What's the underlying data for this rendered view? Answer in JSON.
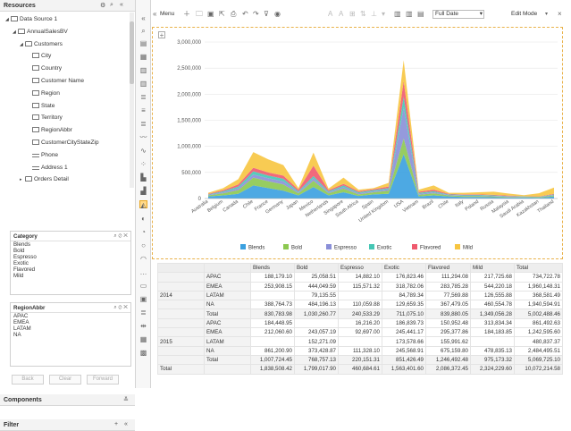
{
  "resources": {
    "title": "Resources",
    "icons": [
      "gear-icon",
      "search-icon",
      "collapse-icon"
    ]
  },
  "tree": [
    {
      "label": "Data Source 1",
      "depth": 0,
      "kind": "db",
      "toggle": "▲"
    },
    {
      "label": "AnnualSalesBV",
      "depth": 1,
      "kind": "folder",
      "toggle": "▲"
    },
    {
      "label": "Customers",
      "depth": 2,
      "kind": "folder",
      "toggle": "▲"
    },
    {
      "label": "City",
      "depth": 3,
      "kind": "field"
    },
    {
      "label": "Country",
      "depth": 3,
      "kind": "check"
    },
    {
      "label": "Customer Name",
      "depth": 3,
      "kind": "field"
    },
    {
      "label": "Region",
      "depth": 3,
      "kind": "field"
    },
    {
      "label": "State",
      "depth": 3,
      "kind": "field"
    },
    {
      "label": "Territory",
      "depth": 3,
      "kind": "field"
    },
    {
      "label": "RegionAbbr",
      "depth": 3,
      "kind": "field"
    },
    {
      "label": "CustomerCityStateZip",
      "depth": 3,
      "kind": "field"
    },
    {
      "label": "Phone",
      "depth": 3,
      "kind": "lines"
    },
    {
      "label": "Address 1",
      "depth": 3,
      "kind": "lines"
    },
    {
      "label": "Orders Detail",
      "depth": 2,
      "kind": "folder",
      "toggle": "▶"
    }
  ],
  "components": {
    "title": "Components"
  },
  "filter": {
    "title": "Filter",
    "add": "+",
    "collapse": "«"
  },
  "category": {
    "title": "Category",
    "values": [
      "Blends",
      "Bold",
      "Espresso",
      "Exotic",
      "Flavored",
      "Mild"
    ]
  },
  "region": {
    "title": "RegionAbbr",
    "values": [
      "APAC",
      "EMEA",
      "LATAM",
      "NA"
    ]
  },
  "buttons": {
    "back": "Back",
    "clear": "Clear",
    "forward": "Forward"
  },
  "toolbar": {
    "menu": "Menu",
    "date": "Full Date",
    "mode": "Edit Mode"
  },
  "chart_data": {
    "type": "area",
    "categories": [
      "Australia",
      "Belgium",
      "Canada",
      "Chile",
      "France",
      "Germany",
      "Japan",
      "Mexico",
      "Netherlands",
      "Singapore",
      "South Africa",
      "Spain",
      "United Kingdom",
      "USA",
      "Vietnam",
      "Brazil",
      "Chile",
      "Italy",
      "Poland",
      "Russia",
      "Malaysia",
      "Saudi Arabia",
      "Kazakhstan",
      "Thailand"
    ],
    "ylim": [
      0,
      3000000
    ],
    "yticks": [
      "0",
      "500,000",
      "1,000,000",
      "1,500,000",
      "2,000,000",
      "2,500,000",
      "3,000,000"
    ],
    "series": [
      {
        "name": "Blends",
        "color": "#3aa0e0",
        "values": [
          40000,
          60000,
          90000,
          250000,
          200000,
          150000,
          60000,
          220000,
          60000,
          120000,
          50000,
          80000,
          90000,
          850000,
          40000,
          60000,
          40000,
          30000,
          30000,
          25000,
          20000,
          20000,
          15000,
          40000
        ]
      },
      {
        "name": "Bold",
        "color": "#8cc850",
        "values": [
          20000,
          40000,
          70000,
          150000,
          130000,
          120000,
          40000,
          120000,
          40000,
          70000,
          30000,
          40000,
          60000,
          300000,
          30000,
          40000,
          20000,
          20000,
          20000,
          15000,
          10000,
          10000,
          10000,
          20000
        ]
      },
      {
        "name": "Espresso",
        "color": "#8a8fd8",
        "values": [
          10000,
          20000,
          40000,
          60000,
          60000,
          60000,
          20000,
          50000,
          20000,
          30000,
          20000,
          20000,
          30000,
          600000,
          20000,
          20000,
          10000,
          10000,
          10000,
          10000,
          10000,
          5000,
          5000,
          10000
        ]
      },
      {
        "name": "Exotic",
        "color": "#45c6b4",
        "values": [
          10000,
          20000,
          30000,
          60000,
          50000,
          50000,
          20000,
          40000,
          20000,
          30000,
          20000,
          20000,
          20000,
          200000,
          20000,
          20000,
          10000,
          10000,
          10000,
          10000,
          5000,
          5000,
          5000,
          10000
        ]
      },
      {
        "name": "Flavored",
        "color": "#ef5a6e",
        "values": [
          10000,
          20000,
          40000,
          70000,
          60000,
          60000,
          30000,
          200000,
          20000,
          30000,
          20000,
          20000,
          30000,
          300000,
          20000,
          30000,
          10000,
          10000,
          10000,
          10000,
          10000,
          5000,
          5000,
          10000
        ]
      },
      {
        "name": "Mild",
        "color": "#f7c540",
        "values": [
          20000,
          40000,
          100000,
          300000,
          250000,
          200000,
          30000,
          250000,
          30000,
          120000,
          30000,
          20000,
          70000,
          400000,
          40000,
          80000,
          20000,
          30000,
          40000,
          60000,
          40000,
          20000,
          60000,
          120000
        ]
      }
    ]
  },
  "table": {
    "headers": [
      "",
      "",
      "Blends",
      "Bold",
      "Espresso",
      "Exotic",
      "Flavored",
      "Mild",
      "Total"
    ],
    "rows": [
      [
        "",
        "APAC",
        "188,179.10",
        "25,058.51",
        "14,882.10",
        "176,823.46",
        "111,294.08",
        "217,725.68",
        "734,722.78"
      ],
      [
        "",
        "EMEA",
        "253,908.15",
        "444,049.59",
        "115,571.32",
        "318,782.06",
        "283,785.28",
        "544,220.18",
        "1,960,148.31"
      ],
      [
        "2014",
        "LATAM",
        "",
        "79,135.55",
        "",
        "84,789.34",
        "77,569.88",
        "126,555.88",
        "368,581.49"
      ],
      [
        "",
        "NA",
        "388,764.73",
        "484,196.13",
        "110,059.88",
        "129,659.35",
        "367,479.05",
        "460,554.78",
        "1,940,594.91"
      ],
      [
        "",
        "Total",
        "830,783.98",
        "1,030,260.77",
        "240,533.29",
        "711,075.10",
        "839,880.05",
        "1,349,056.28",
        "5,002,488.46"
      ],
      [
        "",
        "APAC",
        "184,448.95",
        "",
        "16,216.20",
        "186,839.73",
        "150,952.48",
        "313,834.34",
        "861,492.63"
      ],
      [
        "",
        "EMEA",
        "212,060.60",
        "243,057.19",
        "92,697.00",
        "245,441.17",
        "295,377.86",
        "184,183.85",
        "1,242,595.60"
      ],
      [
        "2015",
        "LATAM",
        "",
        "152,271.09",
        "",
        "173,578.66",
        "155,991.62",
        "",
        "480,837.37"
      ],
      [
        "",
        "NA",
        "861,200.90",
        "373,428.87",
        "111,328.10",
        "245,568.91",
        "675,159.80",
        "478,835.13",
        "2,484,495.51"
      ],
      [
        "",
        "Total",
        "1,007,724.45",
        "768,757.13",
        "220,151.31",
        "851,426.49",
        "1,246,492.48",
        "975,173.32",
        "5,069,725.10"
      ],
      [
        "Total",
        "",
        "1,838,508.42",
        "1,799,017.90",
        "460,684.61",
        "1,563,401.60",
        "2,086,372.45",
        "2,324,229.60",
        "10,072,214.58"
      ]
    ]
  }
}
